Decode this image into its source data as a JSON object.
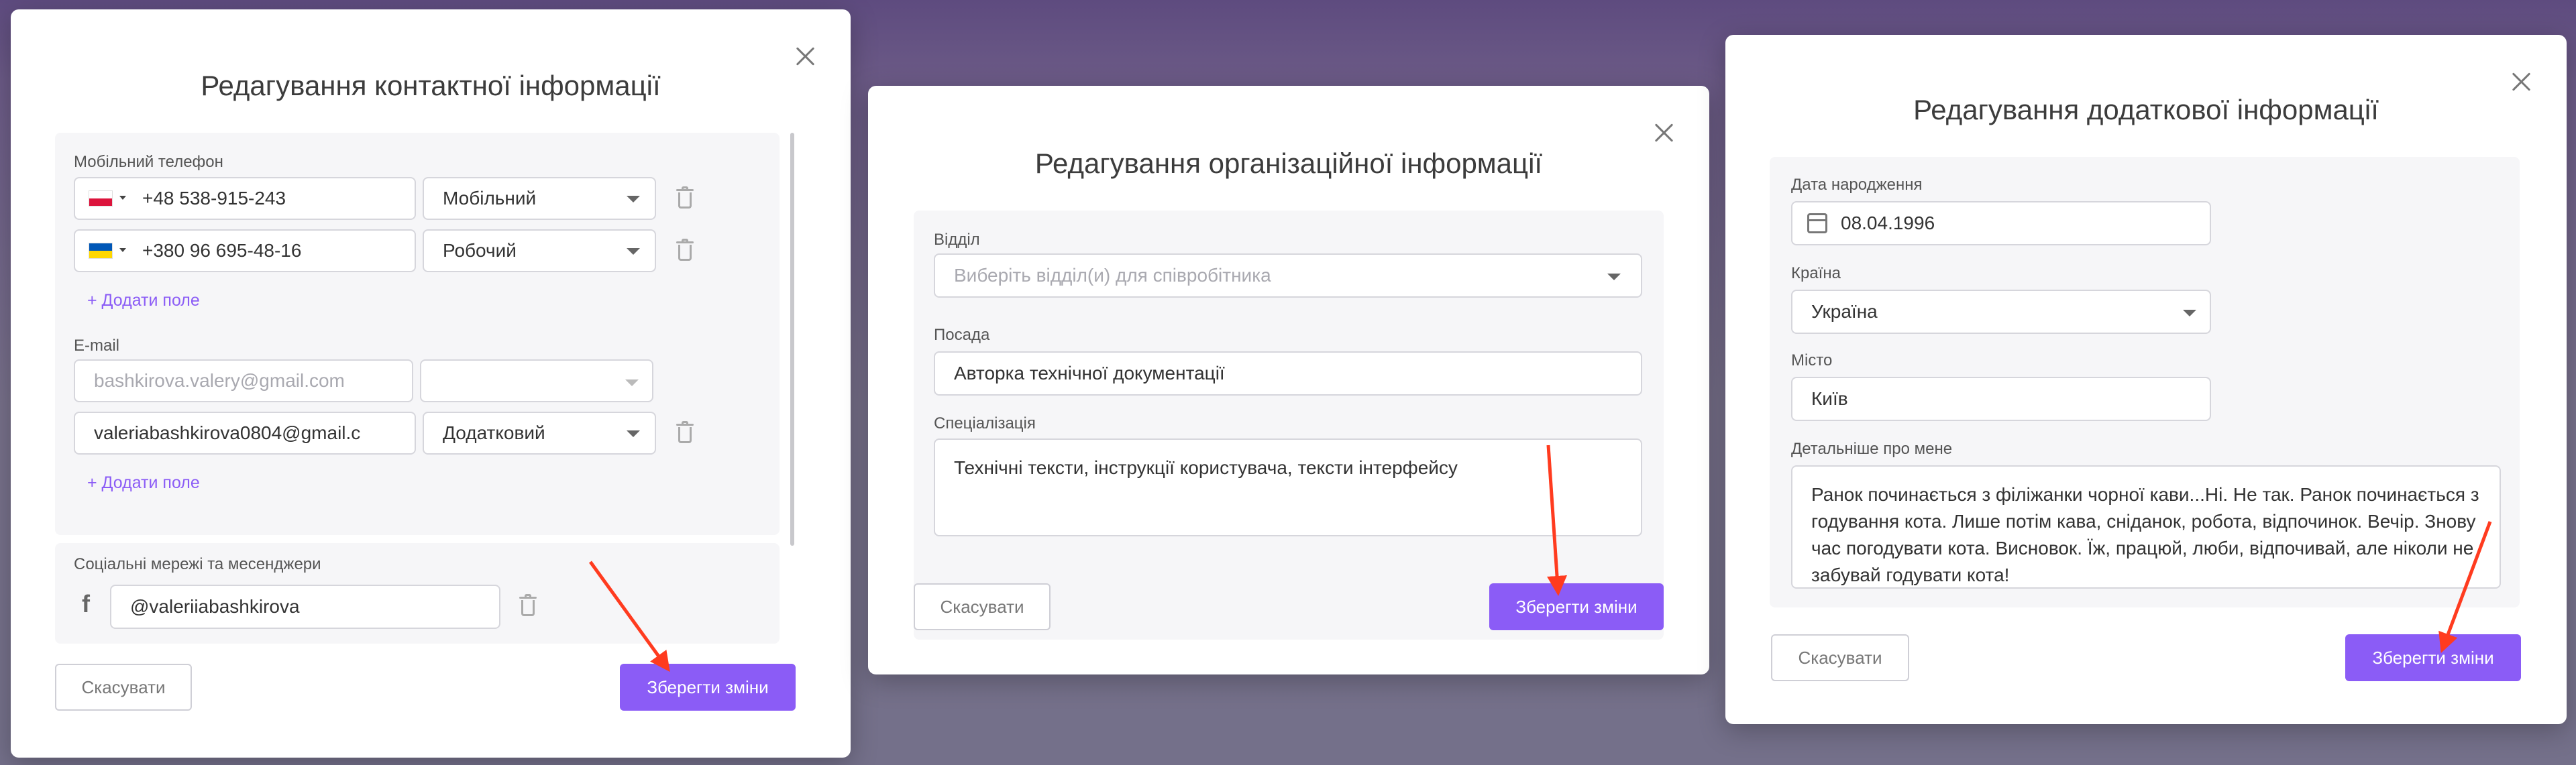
{
  "modal1": {
    "title": "Редагування контактної інформації",
    "mobile_label": "Мобільний телефон",
    "phones": [
      {
        "number": "+48 538-915-243",
        "type": "Мобільний"
      },
      {
        "number": "+380 96 695-48-16",
        "type": "Робочий"
      }
    ],
    "add_field": "+ Додати поле",
    "email_label": "E-mail",
    "emails": [
      {
        "placeholder": "bashkirova.valery@gmail.com",
        "type": ""
      },
      {
        "value": "valeriabashkirova0804@gmail.c",
        "type": "Додатковий"
      }
    ],
    "add_field_2": "+ Додати поле",
    "social_label": "Соціальні мережі та месенджери",
    "social_value": "@valeriiabashkirova",
    "cancel": "Скасувати",
    "save": "Зберегти зміни"
  },
  "modal2": {
    "title": "Редагування організаційної інформації",
    "department_label": "Відділ",
    "department_placeholder": "Виберіть відділ(и) для співробітника",
    "position_label": "Посада",
    "position_value": "Авторка технічної документації",
    "specialization_label": "Спеціалізація",
    "specialization_value": "Технічні тексти, інструкції користувача, тексти інтерфейсу",
    "cancel": "Скасувати",
    "save": "Зберегти зміни"
  },
  "modal3": {
    "title": "Редагування додаткової інформації",
    "birthdate_label": "Дата народження",
    "birthdate_value": "08.04.1996",
    "country_label": "Країна",
    "country_value": "Україна",
    "city_label": "Місто",
    "city_value": "Київ",
    "about_label": "Детальніше про мене",
    "about_value": "Ранок починається з філіжанки чорної кави...Ні. Не так. Ранок починається з годування кота. Лише потім кава, сніданок, робота, відпочинок. Вечір. Знову час погодувати кота. Висновок. Їж, працюй, люби, відпочивай, але ніколи не забувай годувати кота!",
    "cancel": "Скасувати",
    "save": "Зберегти зміни"
  },
  "colors": {
    "accent": "#8b5cf6",
    "annotation_arrow": "#ff3b1f"
  }
}
